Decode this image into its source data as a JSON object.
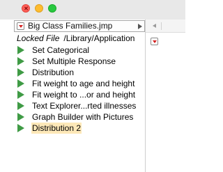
{
  "window": {
    "controls": [
      "close-button",
      "minimize-button",
      "maximize-button"
    ]
  },
  "file": {
    "name": "Big Class Families.jmp",
    "locked_label": "Locked File",
    "path": "/Library/Application"
  },
  "scripts": [
    {
      "label": "Set Categorical",
      "icon": "play-icon"
    },
    {
      "label": "Set Multiple Response",
      "icon": "play-icon"
    },
    {
      "label": "Distribution",
      "icon": "play-icon"
    },
    {
      "label": "Fit weight to age and height",
      "icon": "play-icon"
    },
    {
      "label": "Fit weight to ...or and height",
      "icon": "play-icon"
    },
    {
      "label": "Text Explorer...rted illnesses",
      "icon": "play-icon"
    },
    {
      "label": "Graph Builder with Pictures",
      "icon": "play-icon"
    },
    {
      "label": "Distribution 2",
      "icon": "play-icon",
      "selected": true
    }
  ],
  "colors": {
    "play_icon": "#3f9b45",
    "menu_triangle": "#d42020",
    "selection_highlight": "#fde8b8"
  }
}
